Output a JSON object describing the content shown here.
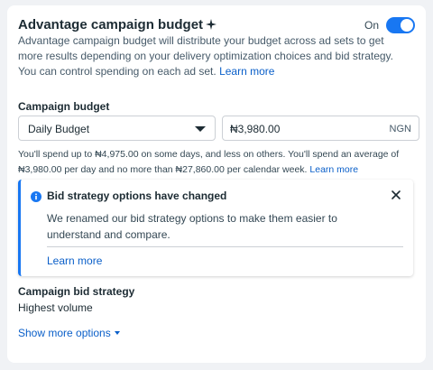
{
  "header": {
    "title": "Advantage campaign budget",
    "toggle_label": "On",
    "toggle_on": true
  },
  "description": {
    "text": "Advantage campaign budget will distribute your budget across ad sets to get more results depending on your delivery optimization choices and bid strategy. You can control spending on each ad set. ",
    "link": "Learn more"
  },
  "budget": {
    "label": "Campaign budget",
    "type_selected": "Daily Budget",
    "amount": "₦3,980.00",
    "currency": "NGN",
    "note_text": "You'll spend up to ₦4,975.00 on some days, and less on others. You'll spend an average of ₦3,980.00 per day and no more than ₦27,860.00 per calendar week. ",
    "note_link": "Learn more"
  },
  "notice": {
    "title": "Bid strategy options have changed",
    "body": "We renamed our bid strategy options to make them easier to understand and compare.",
    "link": "Learn more"
  },
  "bid_strategy": {
    "label": "Campaign bid strategy",
    "value": "Highest volume",
    "more_options": "Show more options"
  },
  "colors": {
    "accent": "#1877f2",
    "link": "#0a5fc9"
  },
  "icons": {
    "sparkle": "sparkle-icon",
    "info": "info-icon",
    "close": "close-icon",
    "caret": "chevron-down-icon"
  }
}
